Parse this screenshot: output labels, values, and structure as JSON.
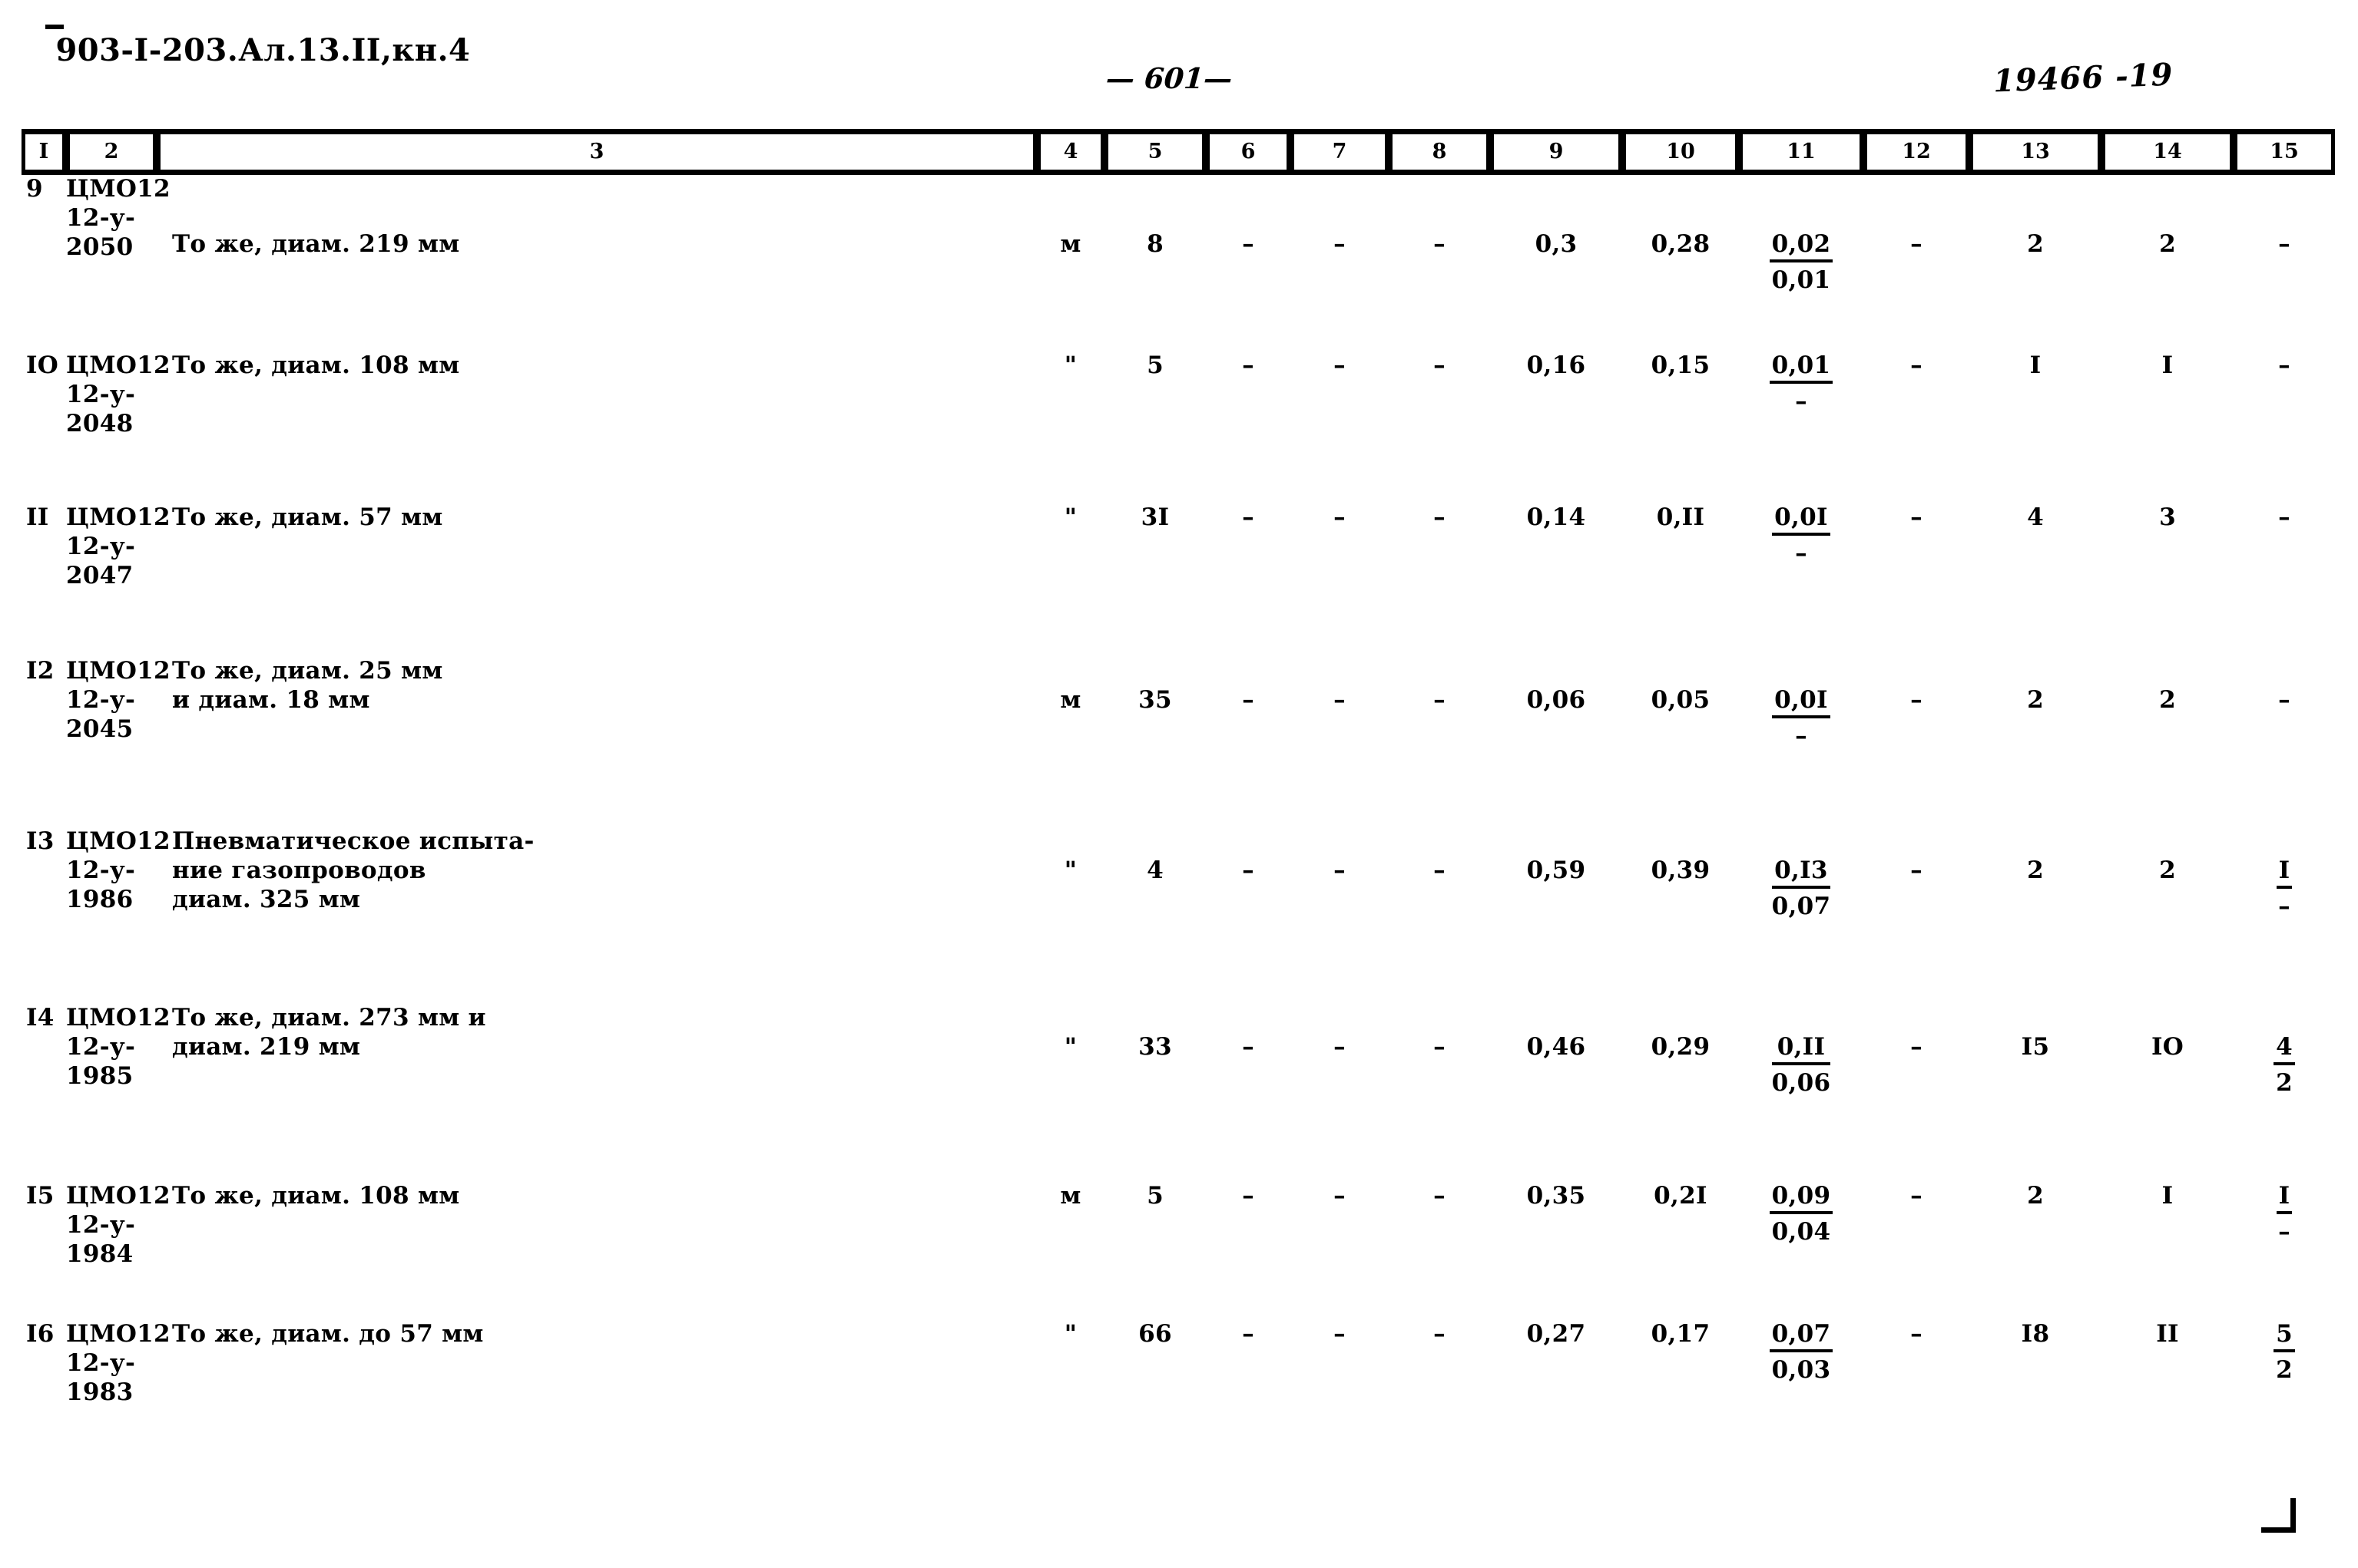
{
  "header": {
    "document_code": "903-I-203.Ал.13.II,кн.4",
    "page_number": "— 601—",
    "stamp_number": "19466 -19"
  },
  "table": {
    "column_headers": [
      "I",
      "2",
      "3",
      "4",
      "5",
      "6",
      "7",
      "8",
      "9",
      "10",
      "11",
      "12",
      "13",
      "14",
      "15"
    ],
    "rows": [
      {
        "num": "9",
        "code": "ЦМО12\n12-у-\n2050",
        "description": "То же, диам. 219 мм",
        "unit": "м",
        "c5": "8",
        "c6": "–",
        "c7": "–",
        "c8": "–",
        "c9": "0,3",
        "c10": "0,28",
        "c11_top": "0,02",
        "c11_bot": "0,01",
        "c12": "–",
        "c13": "2",
        "c14": "2",
        "c15_top": "–",
        "c15_bot": ""
      },
      {
        "num": "IO",
        "code": "ЦМО12\n12-у-\n2048",
        "description": "То же, диам. 108 мм",
        "unit": "\"",
        "c5": "5",
        "c6": "–",
        "c7": "–",
        "c8": "–",
        "c9": "0,16",
        "c10": "0,15",
        "c11_top": "0,01",
        "c11_bot": "–",
        "c12": "–",
        "c13": "I",
        "c14": "I",
        "c15_top": "–",
        "c15_bot": ""
      },
      {
        "num": "II",
        "code": "ЦМО12\n12-у-\n2047",
        "description": "То же, диам. 57 мм",
        "unit": "\"",
        "c5": "3I",
        "c6": "–",
        "c7": "–",
        "c8": "–",
        "c9": "0,14",
        "c10": "0,II",
        "c11_top": "0,0I",
        "c11_bot": "–",
        "c12": "–",
        "c13": "4",
        "c14": "3",
        "c15_top": "–",
        "c15_bot": ""
      },
      {
        "num": "I2",
        "code": "ЦМО12\n12-у-\n2045",
        "description": "То же, диам. 25 мм\nи диам. 18 мм",
        "unit": "м",
        "c5": "35",
        "c6": "–",
        "c7": "–",
        "c8": "–",
        "c9": "0,06",
        "c10": "0,05",
        "c11_top": "0,0I",
        "c11_bot": "–",
        "c12": "–",
        "c13": "2",
        "c14": "2",
        "c15_top": "–",
        "c15_bot": ""
      },
      {
        "num": "I3",
        "code": "ЦМО12\n12-у-\n1986",
        "description": "Пневматическое испыта-\nние газопроводов\nдиам. 325 мм",
        "unit": "\"",
        "c5": "4",
        "c6": "–",
        "c7": "–",
        "c8": "–",
        "c9": "0,59",
        "c10": "0,39",
        "c11_top": "0,I3",
        "c11_bot": "0,07",
        "c12": "–",
        "c13": "2",
        "c14": "2",
        "c15_top": "I",
        "c15_bot": "–"
      },
      {
        "num": "I4",
        "code": "ЦМО12\n12-у-\n1985",
        "description": "То же, диам. 273 мм и\nдиам. 219 мм",
        "unit": "\"",
        "c5": "33",
        "c6": "–",
        "c7": "–",
        "c8": "–",
        "c9": "0,46",
        "c10": "0,29",
        "c11_top": "0,II",
        "c11_bot": "0,06",
        "c12": "–",
        "c13": "I5",
        "c14": "IO",
        "c15_top": "4",
        "c15_bot": "2"
      },
      {
        "num": "I5",
        "code": "ЦМО12\n12-у-\n1984",
        "description": "То же, диам. 108 мм",
        "unit": "м",
        "c5": "5",
        "c6": "–",
        "c7": "–",
        "c8": "–",
        "c9": "0,35",
        "c10": "0,2I",
        "c11_top": "0,09",
        "c11_bot": "0,04",
        "c12": "–",
        "c13": "2",
        "c14": "I",
        "c15_top": "I",
        "c15_bot": "–"
      },
      {
        "num": "I6",
        "code": "ЦМО12\n12-у-\n1983",
        "description": "То же, диам. до 57 мм",
        "unit": "\"",
        "c5": "66",
        "c6": "–",
        "c7": "–",
        "c8": "–",
        "c9": "0,27",
        "c10": "0,17",
        "c11_top": "0,07",
        "c11_bot": "0,03",
        "c12": "–",
        "c13": "I8",
        "c14": "II",
        "c15_top": "5",
        "c15_bot": "2"
      }
    ]
  }
}
